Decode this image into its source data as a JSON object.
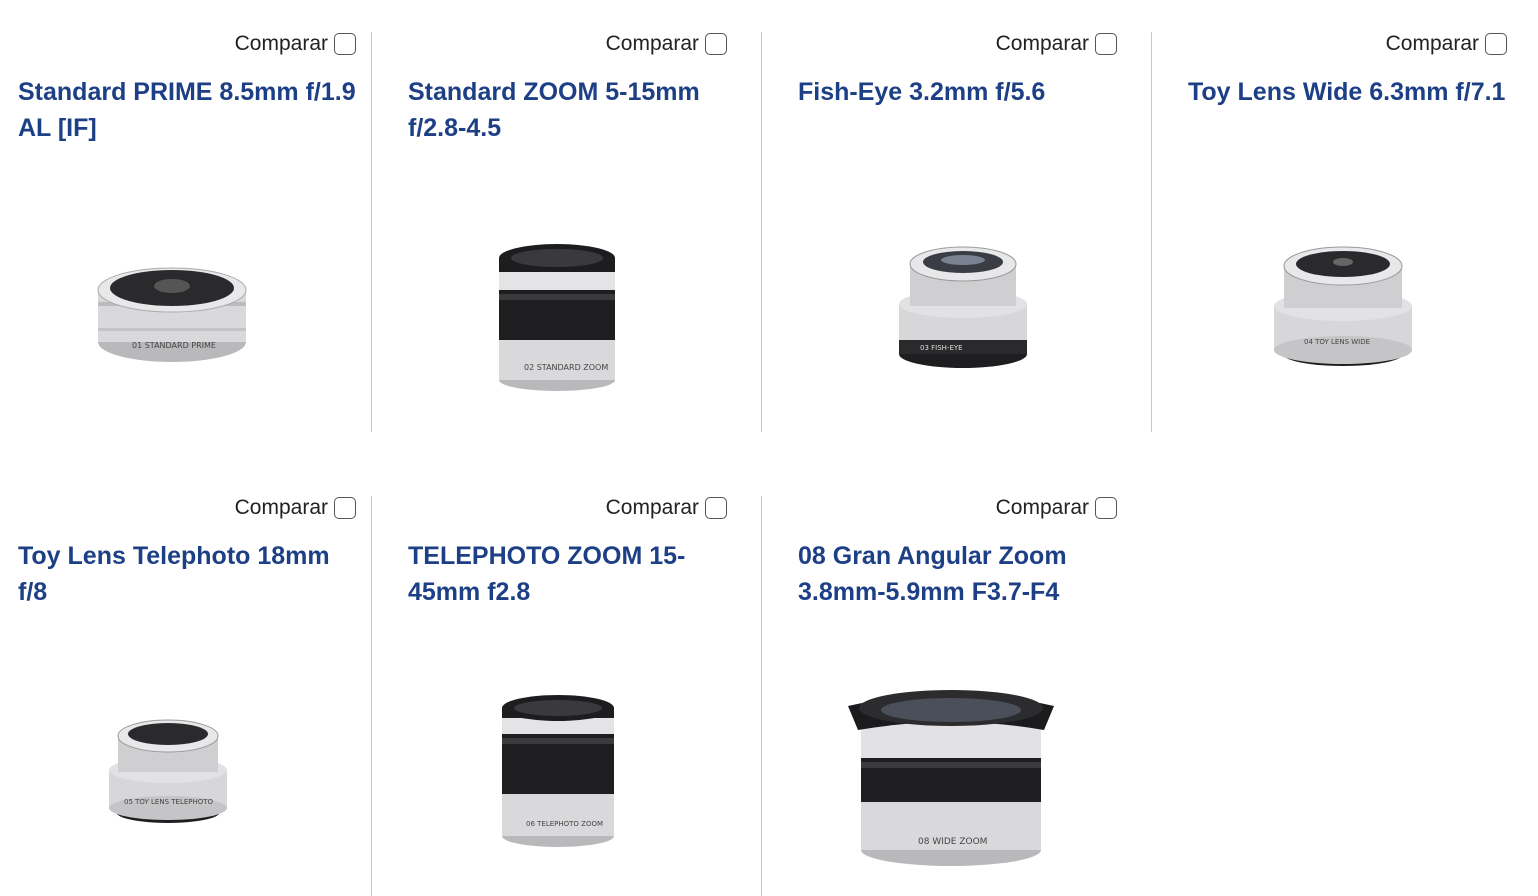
{
  "compare_label": "Comparar",
  "colors": {
    "title": "#1d3f85",
    "divider": "#c8c8c8",
    "silver": "#d7d7d9",
    "black": "#1b1b1b"
  },
  "products": [
    {
      "title": "Standard PRIME 8.5mm f/1.9 AL [IF]",
      "icon": "prime-lens-icon"
    },
    {
      "title": "Standard ZOOM 5-15mm f/2.8-4.5",
      "icon": "zoom-lens-icon"
    },
    {
      "title": "Fish-Eye 3.2mm f/5.6",
      "icon": "fisheye-lens-icon"
    },
    {
      "title": "Toy Lens Wide 6.3mm f/7.1",
      "icon": "toy-wide-lens-icon"
    },
    {
      "title": "Toy Lens Telephoto 18mm f/8",
      "icon": "toy-telephoto-lens-icon"
    },
    {
      "title": "TELEPHOTO ZOOM 15-45mm f2.8",
      "icon": "telephoto-zoom-lens-icon"
    },
    {
      "title": "08 Gran Angular Zoom 3.8mm-5.9mm F3.7-F4",
      "icon": "wide-zoom-lens-icon"
    }
  ]
}
